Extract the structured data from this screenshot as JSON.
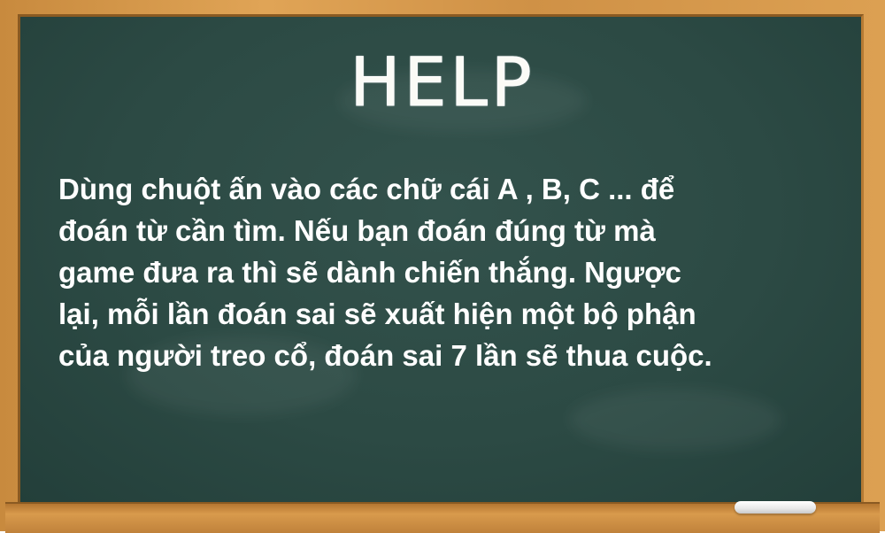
{
  "help_screen": {
    "title": "HELP",
    "instructions": [
      "Dùng chuột ấn vào các chữ cái A , B, C ... để",
      "đoán từ cần tìm. Nếu bạn đoán đúng từ mà",
      "game đưa ra thì sẽ dành chiến thắng. Ngược",
      "lại, mỗi lần đoán sai sẽ xuất hiện một bộ phận",
      "của người treo cổ, đoán sai 7 lần sẽ thua cuộc."
    ]
  },
  "colors": {
    "board": "#2c4a44",
    "frame": "#d39749",
    "text": "#ffffff"
  }
}
